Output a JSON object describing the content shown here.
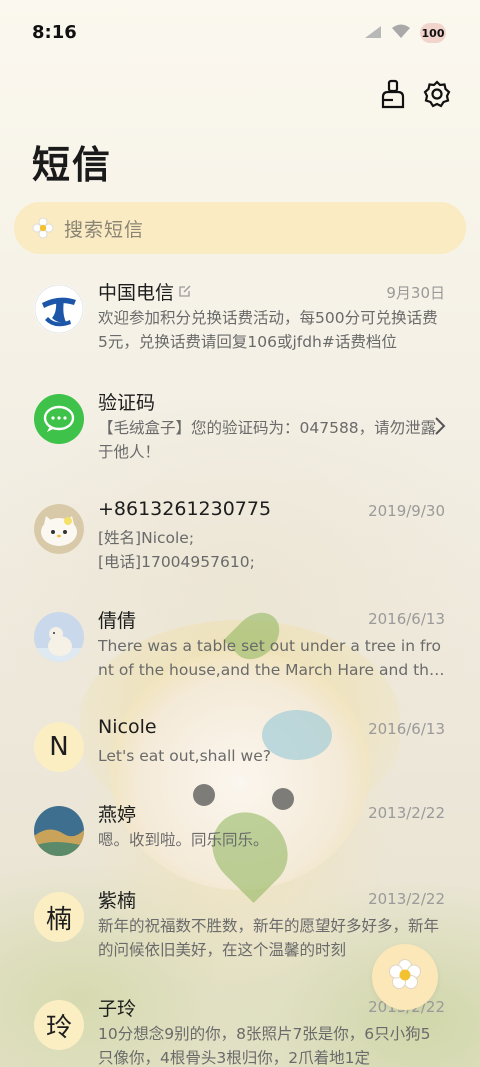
{
  "status_bar": {
    "time": "8:16",
    "battery": "100"
  },
  "header": {
    "title": "短信"
  },
  "search": {
    "placeholder": "搜索短信"
  },
  "threads": [
    {
      "name": "中国电信",
      "date": "9月30日",
      "preview": "欢迎参加积分兑换话费活动，每500分可兑换话费5元，兑换话费请回复106或jfdh#话费档位"
    },
    {
      "name": "验证码",
      "date": "",
      "preview": "【毛绒盒子】您的验证码为：047588，请勿泄露于他人！"
    },
    {
      "name": "+8613261230775",
      "date": "2019/9/30",
      "preview": "[姓名]Nicole;\n[电话]17004957610;"
    },
    {
      "name": "倩倩",
      "date": "2016/6/13",
      "preview": "There was a table set out under a tree in front of the house,and the March Hare and the Hatter"
    },
    {
      "name": "Nicole",
      "avatar_letter": "N",
      "date": "2016/6/13",
      "preview": "Let's eat out,shall we?"
    },
    {
      "name": "燕婷",
      "date": "2013/2/22",
      "preview": "嗯。收到啦。同乐同乐。"
    },
    {
      "name": "紫楠",
      "avatar_letter": "楠",
      "date": "2013/2/22",
      "preview": "新年的祝福数不胜数，新年的愿望好多好多，新年的问候依旧美好，在这个温馨的时刻"
    },
    {
      "name": "子玲",
      "avatar_letter": "玲",
      "date": "2013/2/22",
      "preview": "10分想念9别的你，8张照片7张是你，6只小狗5只像你，4根骨头3根归你，2爪着地1定"
    }
  ],
  "colors": {
    "accent": "#fbeec3",
    "telecom_blue": "#1d56a8",
    "code_green": "#3fc24a"
  },
  "icons": [
    "cleanup-icon",
    "settings-icon",
    "flower-search-icon",
    "chevron-right-icon",
    "flower-compose-icon"
  ]
}
